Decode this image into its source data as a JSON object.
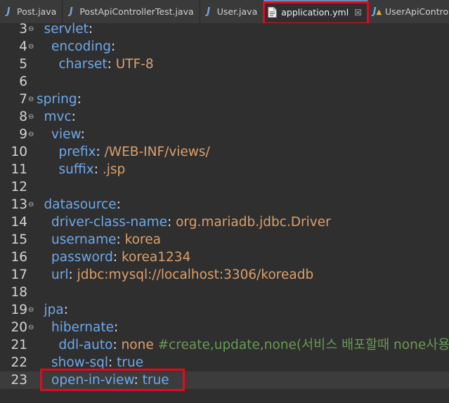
{
  "tabs": [
    {
      "label": "Post.java",
      "icon": "java-file-icon",
      "active": false
    },
    {
      "label": "PostApiControllerTest.java",
      "icon": "java-file-icon",
      "active": false
    },
    {
      "label": "User.java",
      "icon": "java-file-icon",
      "active": false
    },
    {
      "label": "application.yml",
      "icon": "text-file-icon",
      "active": true,
      "close": "☒"
    },
    {
      "label": "UserApiControllerTe",
      "icon": "java-file-warning-icon",
      "active": false
    }
  ],
  "lines": [
    {
      "n": "3",
      "fold": "⊖",
      "key": "servlet",
      "value": ""
    },
    {
      "n": "4",
      "fold": "⊖",
      "key": "encoding",
      "value": ""
    },
    {
      "n": "5",
      "fold": "",
      "key": "charset",
      "value": "UTF-8"
    },
    {
      "n": "6",
      "fold": "",
      "key": "",
      "value": ""
    },
    {
      "n": "7",
      "fold": "⊖",
      "key": "spring",
      "value": ""
    },
    {
      "n": "8",
      "fold": "⊖",
      "key": "mvc",
      "value": ""
    },
    {
      "n": "9",
      "fold": "⊖",
      "key": "view",
      "value": ""
    },
    {
      "n": "10",
      "fold": "",
      "key": "prefix",
      "value": "/WEB-INF/views/"
    },
    {
      "n": "11",
      "fold": "",
      "key": "suffix",
      "value": ".jsp"
    },
    {
      "n": "12",
      "fold": "",
      "key": "",
      "value": ""
    },
    {
      "n": "13",
      "fold": "⊖",
      "key": "datasource",
      "value": ""
    },
    {
      "n": "14",
      "fold": "",
      "key": "driver-class-name",
      "value": "org.mariadb.jdbc.Driver"
    },
    {
      "n": "15",
      "fold": "",
      "key": "username",
      "value": "korea"
    },
    {
      "n": "16",
      "fold": "",
      "key": "password",
      "value": "korea1234"
    },
    {
      "n": "17",
      "fold": "",
      "key": "url",
      "value": "jdbc:mysql://localhost:3306/koreadb"
    },
    {
      "n": "18",
      "fold": "",
      "key": "",
      "value": ""
    },
    {
      "n": "19",
      "fold": "⊖",
      "key": "jpa",
      "value": ""
    },
    {
      "n": "20",
      "fold": "⊖",
      "key": "hibernate",
      "value": ""
    },
    {
      "n": "21",
      "fold": "",
      "key": "ddl-auto",
      "value": "none",
      "comment": "#create,update,none(서비스 배포할때 none사용"
    },
    {
      "n": "22",
      "fold": "",
      "key": "show-sql",
      "value": "true"
    },
    {
      "n": "23",
      "fold": "",
      "key": "open-in-view",
      "value": "true"
    }
  ],
  "colors": {
    "key": "#6ea9ec",
    "value": "#dca06b",
    "comment": "#6a9955",
    "highlight": "#e5091f"
  }
}
